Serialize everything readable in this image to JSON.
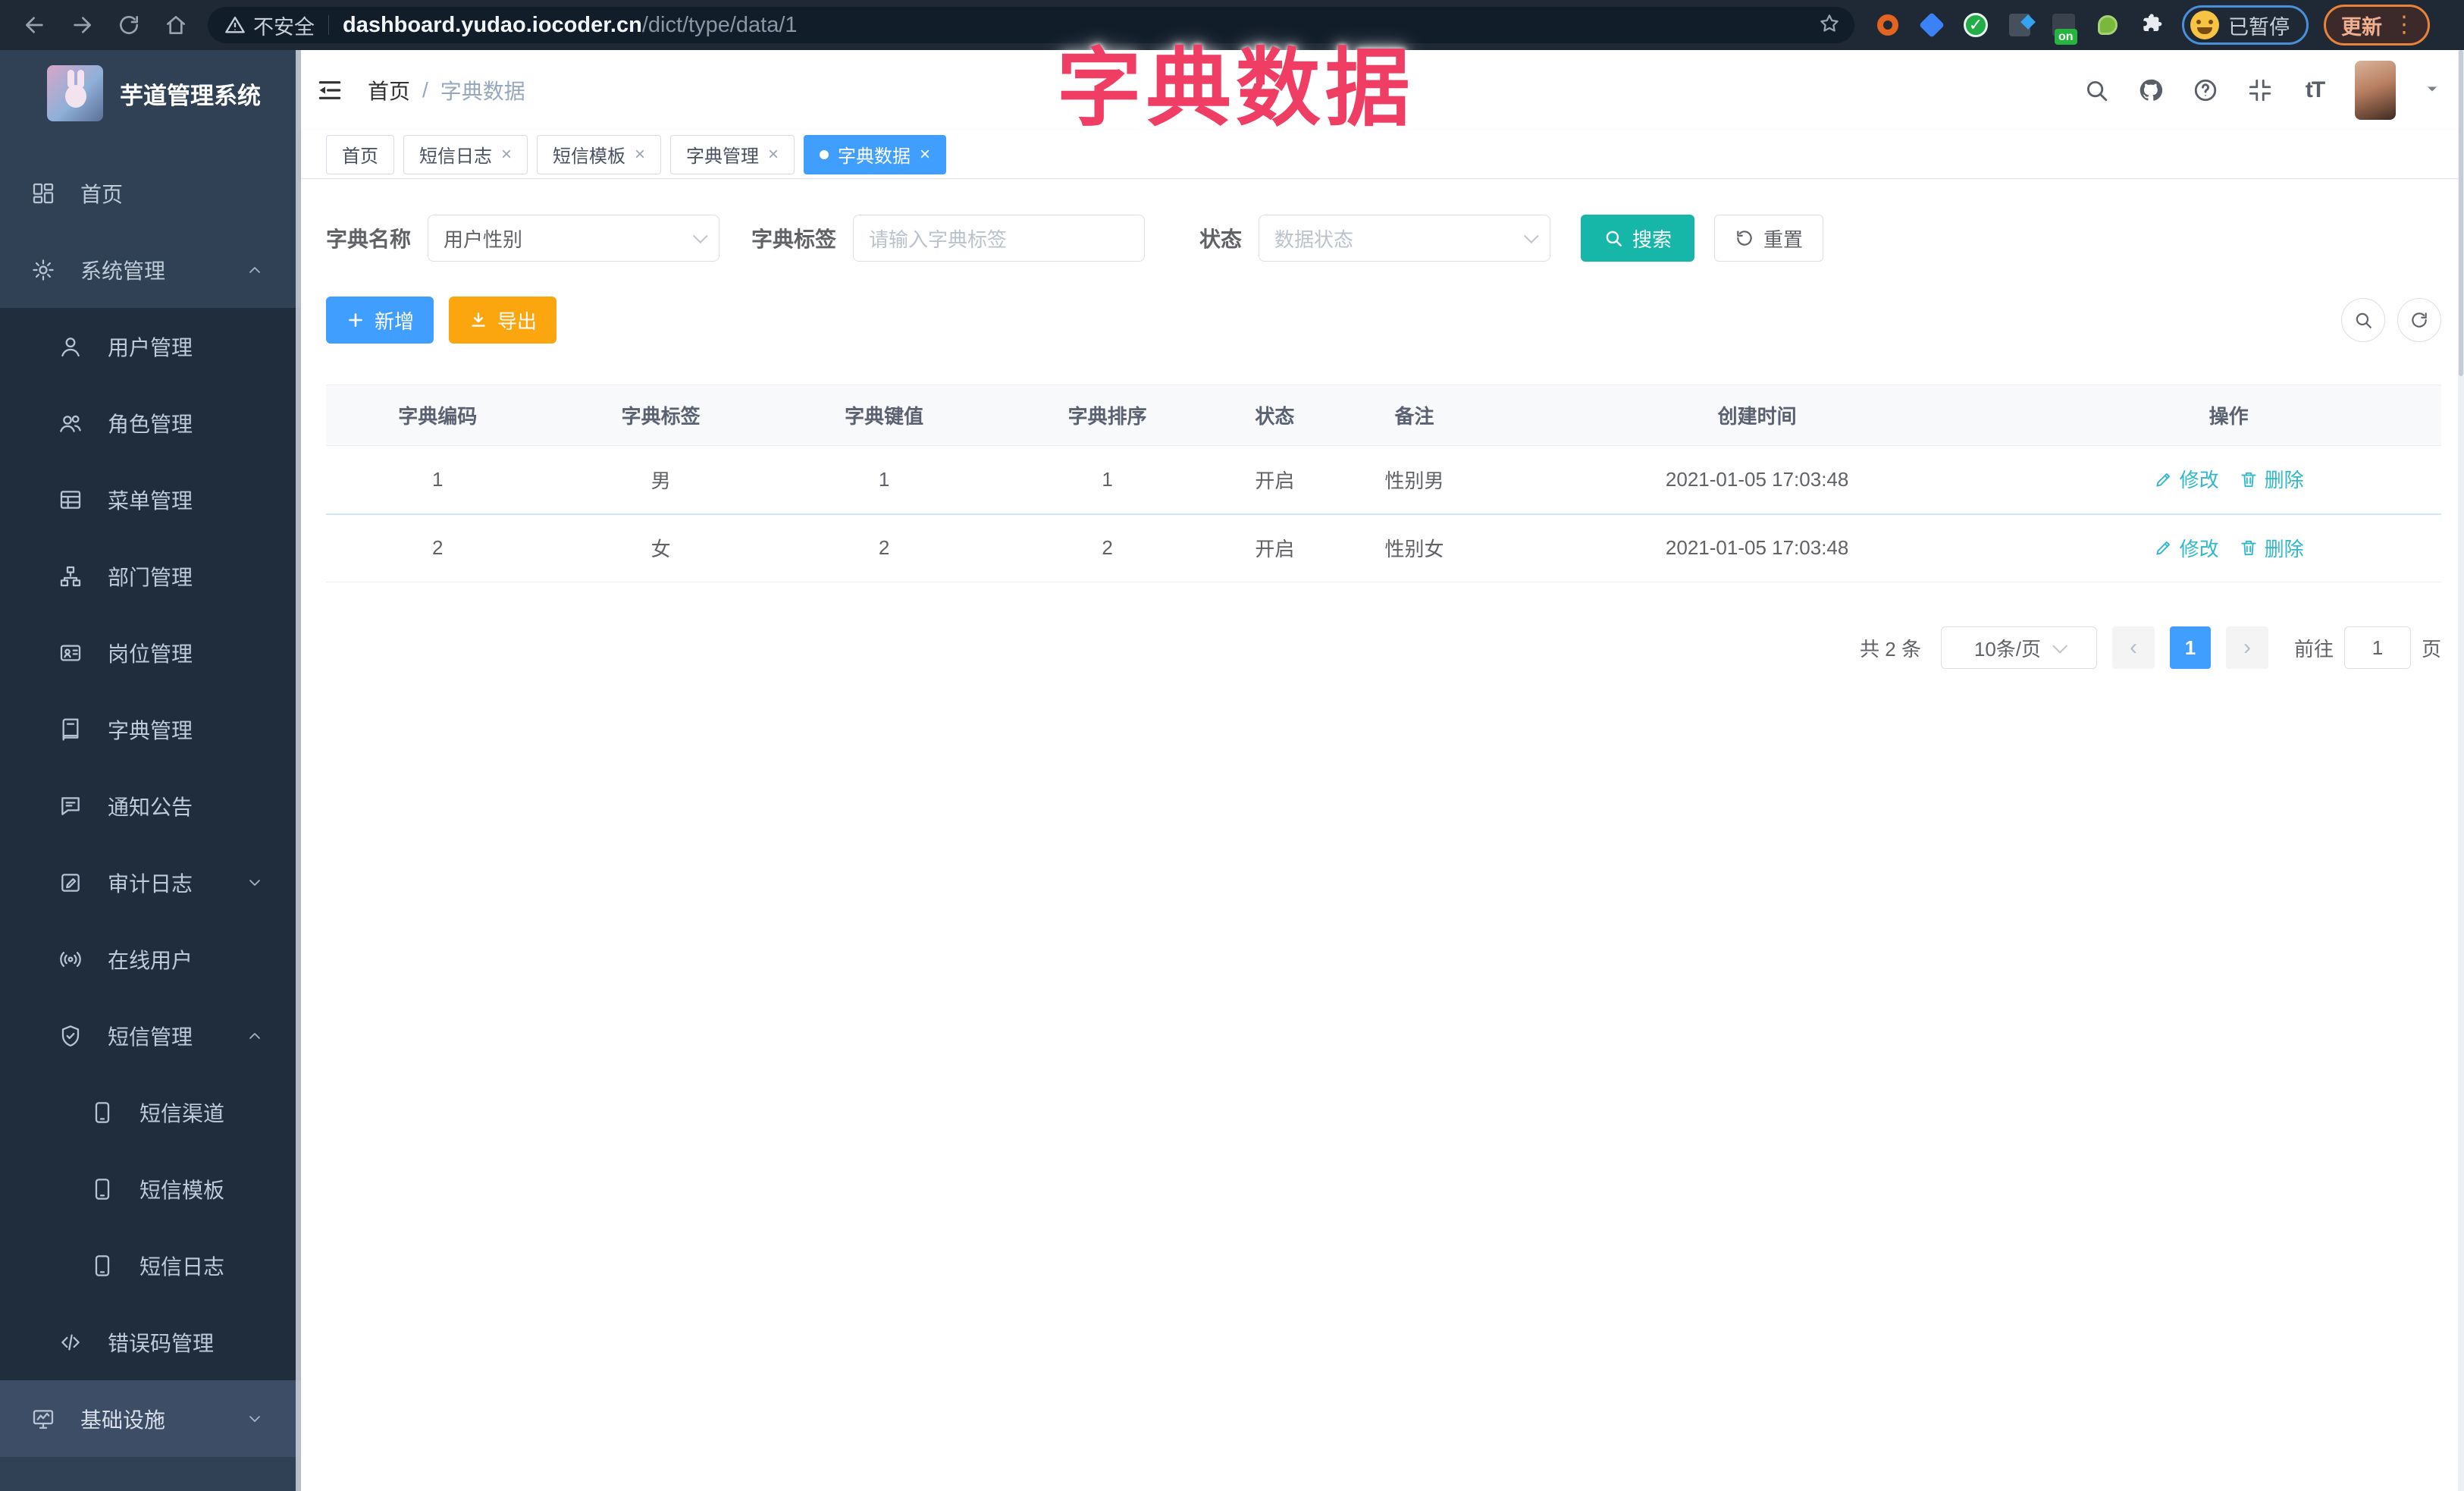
{
  "colors": {
    "primary": "#409eff",
    "teal": "#16b7a8",
    "orange": "#fba50f",
    "link": "#2fb8cc",
    "overlay": "#ef3d63",
    "side_bg": "#304156",
    "side_sub": "#1f2d3d",
    "side_hl": "#3e4d66"
  },
  "overlay_title": "字典数据",
  "browser": {
    "security_label": "不安全",
    "url_host": "dashboard.yudao.iocoder.cn",
    "url_path": "/dict/type/data/1",
    "on_badge": "on",
    "paused_label": "已暂停",
    "update_label": "更新"
  },
  "sidebar": {
    "title": "芋道管理系统",
    "items": [
      {
        "label": "首页",
        "icon": "dashboard-icon",
        "level": 0
      },
      {
        "label": "系统管理",
        "icon": "gear-icon",
        "level": 0,
        "arrow": "up"
      },
      {
        "label": "用户管理",
        "icon": "user-icon",
        "level": 1
      },
      {
        "label": "角色管理",
        "icon": "peoples-icon",
        "level": 1
      },
      {
        "label": "菜单管理",
        "icon": "menu-list-icon",
        "level": 1
      },
      {
        "label": "部门管理",
        "icon": "tree-icon",
        "level": 1
      },
      {
        "label": "岗位管理",
        "icon": "post-icon",
        "level": 1
      },
      {
        "label": "字典管理",
        "icon": "dict-icon",
        "level": 1
      },
      {
        "label": "通知公告",
        "icon": "message-icon",
        "level": 1
      },
      {
        "label": "审计日志",
        "icon": "log-icon",
        "level": 1,
        "arrow": "down"
      },
      {
        "label": "在线用户",
        "icon": "online-icon",
        "level": 1
      },
      {
        "label": "短信管理",
        "icon": "sms-shield-icon",
        "level": 1,
        "arrow": "up"
      },
      {
        "label": "短信渠道",
        "icon": "phone-icon",
        "level": 2
      },
      {
        "label": "短信模板",
        "icon": "phone-icon",
        "level": 2
      },
      {
        "label": "短信日志",
        "icon": "phone-icon",
        "level": 2
      },
      {
        "label": "错误码管理",
        "icon": "code-icon",
        "level": 1
      },
      {
        "label": "基础设施",
        "icon": "monitor-icon",
        "level": 0,
        "arrow": "down",
        "highlight": true
      }
    ]
  },
  "breadcrumb": {
    "home": "首页",
    "separator": "/",
    "current": "字典数据"
  },
  "tabs": [
    {
      "label": "首页",
      "closable": false,
      "active": false
    },
    {
      "label": "短信日志",
      "closable": true,
      "active": false
    },
    {
      "label": "短信模板",
      "closable": true,
      "active": false
    },
    {
      "label": "字典管理",
      "closable": true,
      "active": false
    },
    {
      "label": "字典数据",
      "closable": true,
      "active": true
    }
  ],
  "filters": {
    "name_label": "字典名称",
    "name_value": "用户性别",
    "tag_label": "字典标签",
    "tag_placeholder": "请输入字典标签",
    "status_label": "状态",
    "status_placeholder": "数据状态",
    "search_label": "搜索",
    "reset_label": "重置"
  },
  "toolbar": {
    "add_label": "新增",
    "export_label": "导出"
  },
  "table": {
    "headers": [
      "字典编码",
      "字典标签",
      "字典键值",
      "字典排序",
      "状态",
      "备注",
      "创建时间",
      "操作"
    ],
    "rows": [
      [
        "1",
        "男",
        "1",
        "1",
        "开启",
        "性别男",
        "2021-01-05 17:03:48"
      ],
      [
        "2",
        "女",
        "2",
        "2",
        "开启",
        "性别女",
        "2021-01-05 17:03:48"
      ]
    ],
    "edit_label": "修改",
    "delete_label": "删除"
  },
  "pagination": {
    "total": "共 2 条",
    "page_size": "10条/页",
    "current_page": "1",
    "goto_label": "前往",
    "goto_value": "1",
    "page_suffix": "页"
  }
}
